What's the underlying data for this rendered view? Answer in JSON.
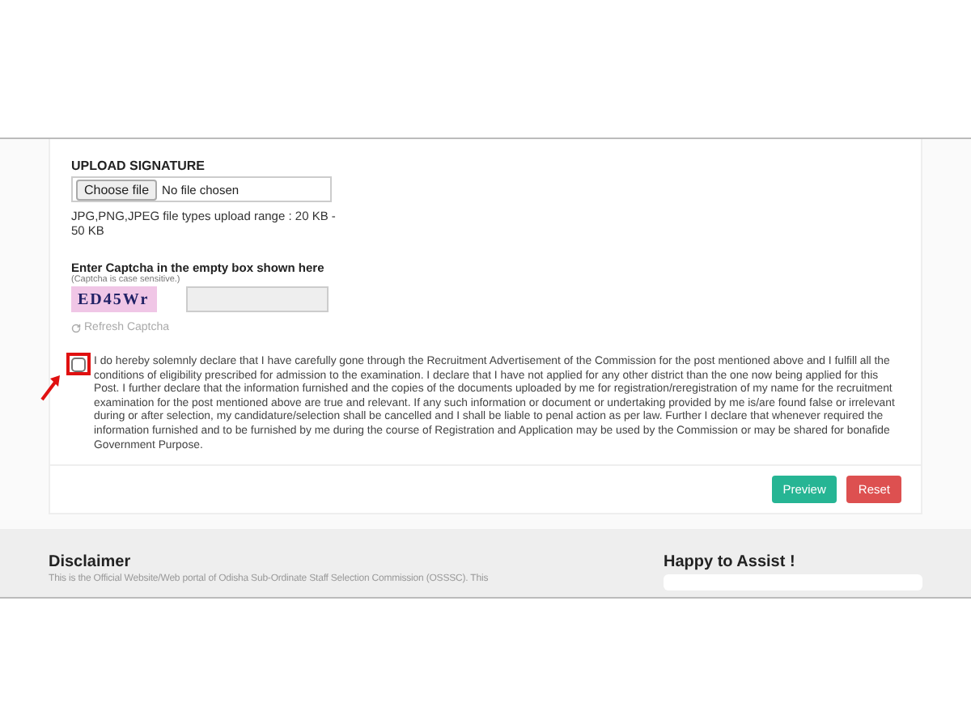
{
  "signature": {
    "label": "UPLOAD SIGNATURE",
    "button": "Choose file",
    "status": "No file chosen",
    "hint": "JPG,PNG,JPEG file types upload range : 20 KB - 50 KB"
  },
  "captcha": {
    "label": "Enter Captcha in the empty box shown here",
    "note": "(Captcha is case sensitive.)",
    "code": "ED45Wr",
    "refresh": "Refresh Captcha"
  },
  "declaration": {
    "checked": false,
    "highlighted": true,
    "text": "I do hereby solemnly declare that I have carefully gone through the Recruitment Advertisement of the Commission for the post mentioned above and I fulfill all the conditions of eligibility prescribed for admission to the examination. I declare that I have not applied for any other district than the one now being applied for this Post. I further declare that the information furnished and the copies of the documents uploaded by me for registration/reregistration of my name for the recruitment examination for the post mentioned above are true and relevant. If any such information or document or undertaking provided by me is/are found false or irrelevant during or after selection, my candidature/selection shall be cancelled and I shall be liable to penal action as per law. Further I declare that whenever required the information furnished and to be furnished by me during the course of Registration and Application may be used by the Commission or may be shared for bonafide Government Purpose."
  },
  "buttons": [
    {
      "label": "Preview",
      "kind": "primary"
    },
    {
      "label": "Reset",
      "kind": "danger"
    }
  ],
  "footer": {
    "disclaimer_title": "Disclaimer",
    "disclaimer_text": "This is the Official Website/Web portal of Odisha Sub-Ordinate Staff Selection Commission (OSSSC). This",
    "assist_title": "Happy to Assist !"
  }
}
